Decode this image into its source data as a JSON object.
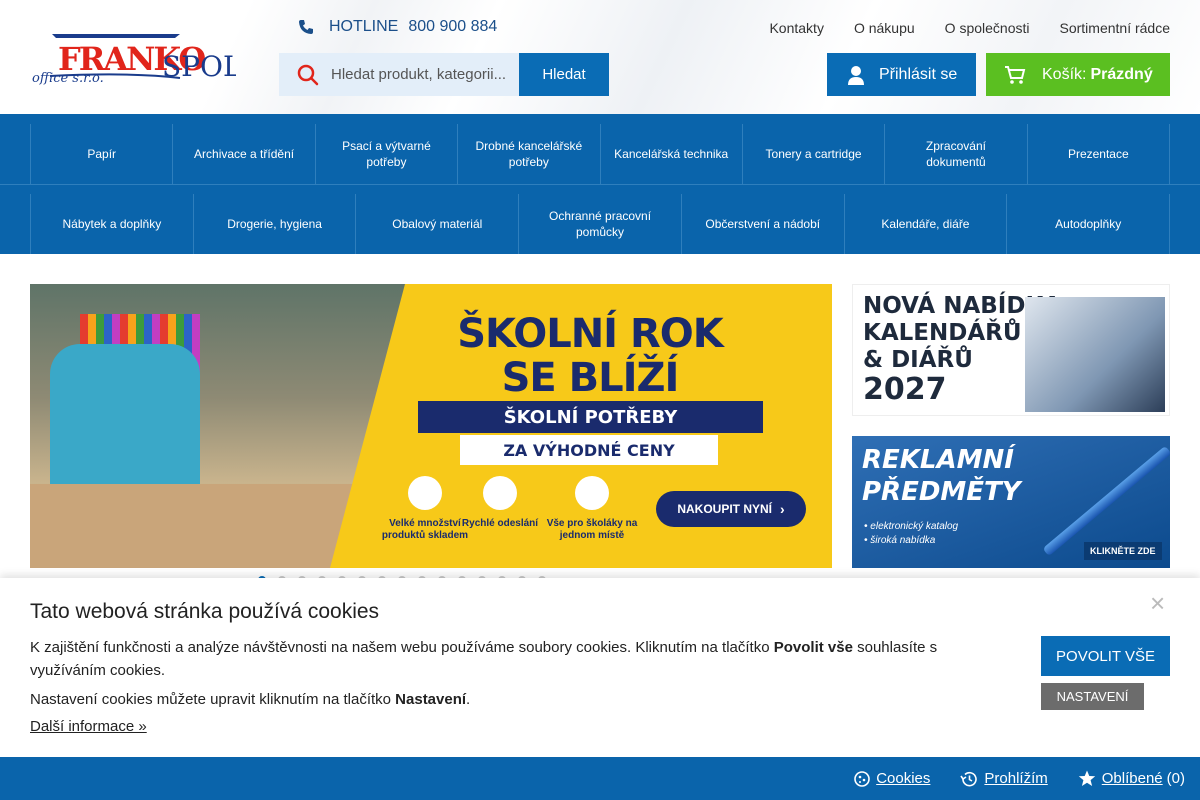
{
  "header": {
    "logo_text": "FRANKO SPOL office s.r.o.",
    "hotline_label": "HOTLINE",
    "hotline_number": "800 900 884",
    "search_placeholder": "Hledat produkt, kategorii...",
    "search_button": "Hledat",
    "top_links": [
      "Kontakty",
      "O nákupu",
      "O společnosti",
      "Sortimentní rádce"
    ],
    "login_label": "Přihlásit se",
    "cart_label": "Košík:",
    "cart_status": "Prázdný",
    "accent_blue": "#0a6cb5",
    "accent_green": "#5bbf21"
  },
  "nav": {
    "row1": [
      "Papír",
      "Archivace a třídění",
      "Psací a výtvarné potřeby",
      "Drobné kancelářské potřeby",
      "Kancelářská technika",
      "Tonery a cartridge",
      "Zpracování dokumentů",
      "Prezentace"
    ],
    "row2": [
      "Nábytek a doplňky",
      "Drogerie, hygiena",
      "Obalový materiál",
      "Ochranné pracovní pomůcky",
      "Občerstvení a nádobí",
      "Kalendáře, diáře",
      "Autodoplňky"
    ]
  },
  "hero": {
    "headline_1": "ŠKOLNÍ ROK",
    "headline_2": "SE BLÍŽÍ",
    "band_1": "ŠKOLNÍ POTŘEBY",
    "band_2": "ZA VÝHODNÉ CENY",
    "features": [
      "Velké množství produktů skladem",
      "Rychlé odeslání",
      "Vše pro školáky na jednom místě"
    ],
    "cta": "NAKOUPIT NYNÍ",
    "slide_count": 15,
    "active_slide": 1
  },
  "banners": {
    "b1_line1": "NOVÁ NABÍDKA",
    "b1_line2": "KALENDÁŘŮ",
    "b1_line3": "& DIÁŘŮ",
    "b1_year": "2027",
    "b2_line1": "REKLAMNÍ",
    "b2_line2": "PŘEDMĚTY",
    "b2_bullet1": "• elektronický katalog",
    "b2_bullet2": "• široká nabídka",
    "b2_cta": "KLIKNĚTE ZDE"
  },
  "cookie": {
    "title": "Tato webová stránka používá cookies",
    "p1_before": "K zajištění funkčnosti a analýze návštěvnosti na našem webu používáme soubory cookies. Kliknutím na tlačítko ",
    "p1_bold": "Povolit vše",
    "p1_after": " souhlasíte s využíváním cookies.",
    "p2_before": "Nastavení cookies můžete upravit kliknutím na tlačítko ",
    "p2_bold": "Nastavení",
    "p2_after": ".",
    "more_link": "Další informace »",
    "allow_button": "POVOLIT VŠE",
    "settings_button": "NASTAVENÍ",
    "close_symbol": "×"
  },
  "bottombar": {
    "cookies": "Cookies",
    "history": "Prohlížím",
    "favorites": "Oblíbené",
    "favorites_count": "(0)"
  }
}
